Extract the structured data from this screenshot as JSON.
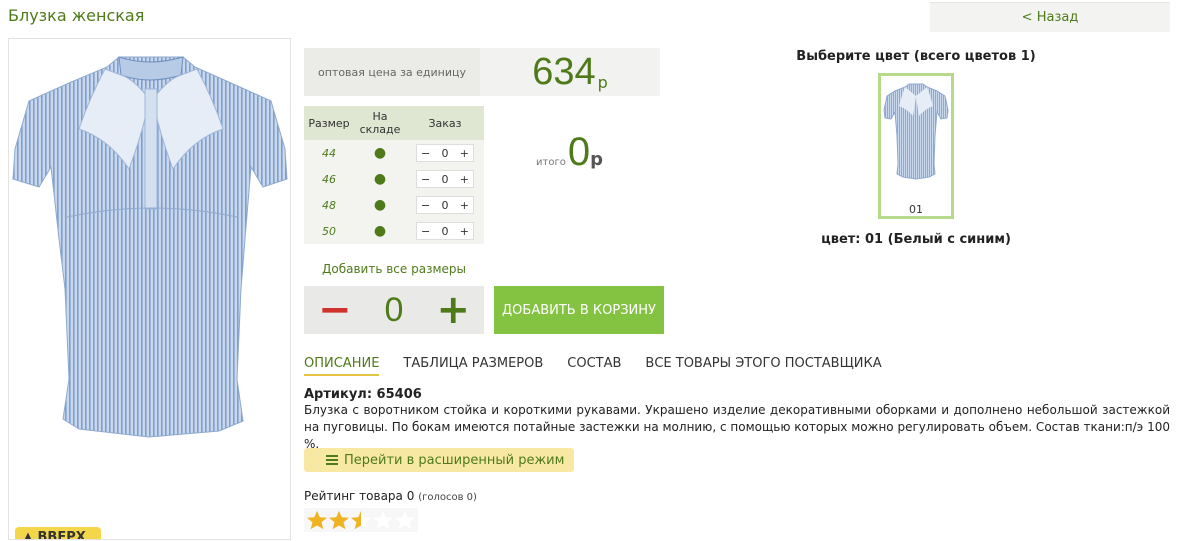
{
  "page_title": "Блузка женская",
  "back_label": "< Назад",
  "price": {
    "label": "оптовая цена за единицу",
    "value": "634",
    "currency": "р"
  },
  "sizes_table": {
    "headers": [
      "Размер",
      "На складе",
      "Заказ"
    ],
    "rows": [
      {
        "size": "44",
        "stock": "●",
        "qty": "0"
      },
      {
        "size": "46",
        "stock": "●",
        "qty": "0"
      },
      {
        "size": "48",
        "stock": "●",
        "qty": "0"
      },
      {
        "size": "50",
        "stock": "●",
        "qty": "0"
      }
    ],
    "minus": "−",
    "plus": "+"
  },
  "total": {
    "label": "итого",
    "value": "0",
    "currency": "р"
  },
  "add_all_label": "Добавить все размеры",
  "big_stepper": {
    "minus": "−",
    "qty": "0",
    "plus": "+"
  },
  "add_to_cart_label": "ДОБАВИТЬ В КОРЗИНУ",
  "tabs": [
    "ОПИСАНИЕ",
    "ТАБЛИЦА РАЗМЕРОВ",
    "СОСТАВ",
    "ВСЕ ТОВАРЫ ЭТОГО ПОСТАВЩИКА"
  ],
  "sku": "Артикул: 65406",
  "description": "Блузка с воротником стойка и короткими рукавами. Украшено изделие декоративными оборками и дополнено небольшой застежкой на пуговицы. По бокам имеются потайные застежки на молнию, с помощью которых можно регулировать объем. Состав ткани:п/э 100 %.",
  "extended_mode_label": "Перейти в расширенный режим",
  "rating": {
    "label": "Рейтинг товара 0",
    "votes": "(голосов 0)",
    "stars_filled": 2.5,
    "stars_total": 5
  },
  "up_button_label": "▲ ВВЕРХ",
  "colors": {
    "heading": "Выберите цвет (всего цветов 1)",
    "thumb_code": "01",
    "selected": "цвет: 01 (Белый с синим)"
  },
  "colors_palette": {
    "accent": "#4e7a1a",
    "cart": "#84c341",
    "minus": "#d0312d",
    "star": "#f0b323"
  }
}
